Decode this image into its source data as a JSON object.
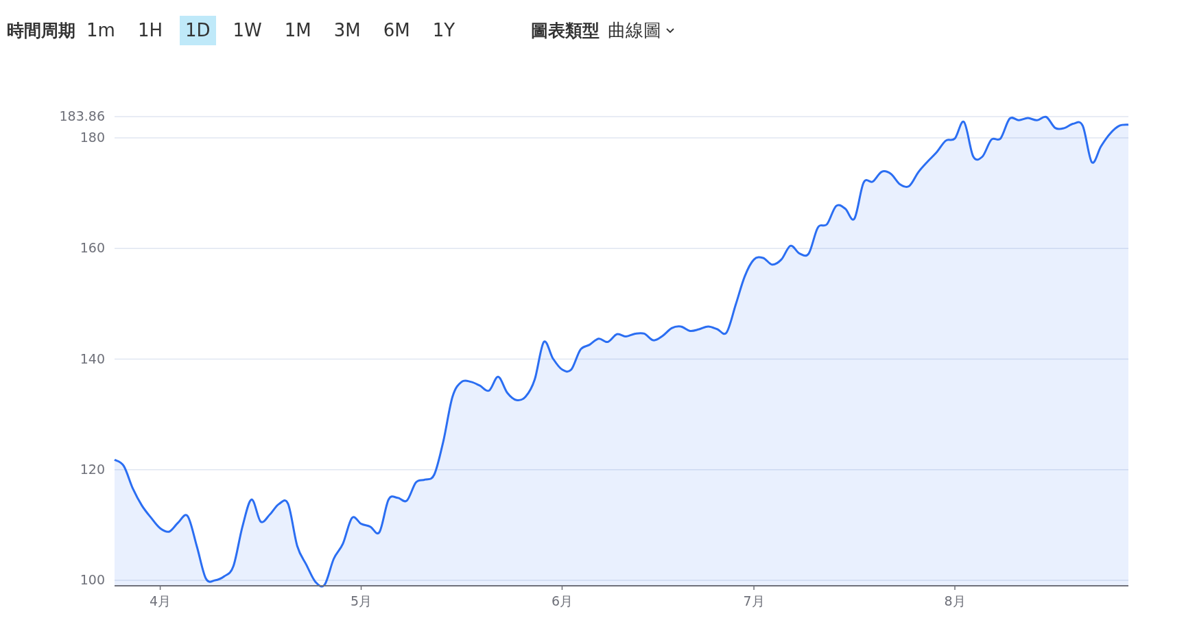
{
  "time_period": {
    "label": "時間周期",
    "options": [
      {
        "label": "1m",
        "selected": false
      },
      {
        "label": "1H",
        "selected": false
      },
      {
        "label": "1D",
        "selected": true
      },
      {
        "label": "1W",
        "selected": false
      },
      {
        "label": "1M",
        "selected": false
      },
      {
        "label": "3M",
        "selected": false
      },
      {
        "label": "6M",
        "selected": false
      },
      {
        "label": "1Y",
        "selected": false
      }
    ]
  },
  "chart_type": {
    "label": "圖表類型",
    "value": "曲線圖"
  },
  "chart": {
    "chart_data": {
      "type": "area",
      "grid": true,
      "ylim": [
        99,
        183.86
      ],
      "categories": [
        null,
        null,
        null,
        null,
        null,
        "4月",
        null,
        null,
        null,
        null,
        null,
        null,
        null,
        null,
        null,
        null,
        null,
        null,
        null,
        null,
        null,
        null,
        null,
        null,
        null,
        null,
        null,
        "5月",
        null,
        null,
        null,
        null,
        null,
        null,
        null,
        null,
        null,
        null,
        null,
        null,
        null,
        null,
        null,
        null,
        null,
        null,
        null,
        null,
        null,
        "6月",
        null,
        null,
        null,
        null,
        null,
        null,
        null,
        null,
        null,
        null,
        null,
        null,
        null,
        null,
        null,
        null,
        null,
        null,
        null,
        null,
        "7月",
        null,
        null,
        null,
        null,
        null,
        null,
        null,
        null,
        null,
        null,
        null,
        null,
        null,
        null,
        null,
        null,
        null,
        null,
        null,
        null,
        null,
        "8月",
        null,
        null,
        null,
        null,
        null,
        null,
        null,
        null,
        null,
        null,
        null,
        null,
        null,
        null,
        null,
        null,
        null,
        null,
        null
      ],
      "yticks": [
        100,
        120,
        140,
        160,
        180,
        183.86
      ],
      "series": [
        {
          "color": "#2b6ef2",
          "values": [
            121.8,
            120.7,
            116.6,
            113.5,
            111.3,
            109.4,
            108.8,
            110.5,
            111.6,
            106.2,
            100.3,
            100,
            100.7,
            102.5,
            109.7,
            114.6,
            110.6,
            111.9,
            113.8,
            113.8,
            106.2,
            102.8,
            99.7,
            99.2,
            103.9,
            106.6,
            111.3,
            110.2,
            109.7,
            108.7,
            114.6,
            114.9,
            114.4,
            117.7,
            118.2,
            119.1,
            125.2,
            133.2,
            135.9,
            135.9,
            135.2,
            134.3,
            136.8,
            133.9,
            132.6,
            133.2,
            136.3,
            143.1,
            140.1,
            138.1,
            138.1,
            141.7,
            142.6,
            143.7,
            143.1,
            144.5,
            144.1,
            144.6,
            144.6,
            143.4,
            144.2,
            145.6,
            145.9,
            145.1,
            145.4,
            145.9,
            145.4,
            144.8,
            149.8,
            155,
            158,
            158.3,
            157.1,
            158,
            160.5,
            159.1,
            159.1,
            163.8,
            164.4,
            167.7,
            167.2,
            165.4,
            171.9,
            172.1,
            173.9,
            173.5,
            171.6,
            171.3,
            173.8,
            175.7,
            177.4,
            179.5,
            179.9,
            182.9,
            176.7,
            176.6,
            179.7,
            179.9,
            183.5,
            183.2,
            183.6,
            183.2,
            183.8,
            181.8,
            181.8,
            182.6,
            182.2,
            175.6,
            178.5,
            180.8,
            182.2,
            182.4
          ]
        }
      ]
    }
  }
}
